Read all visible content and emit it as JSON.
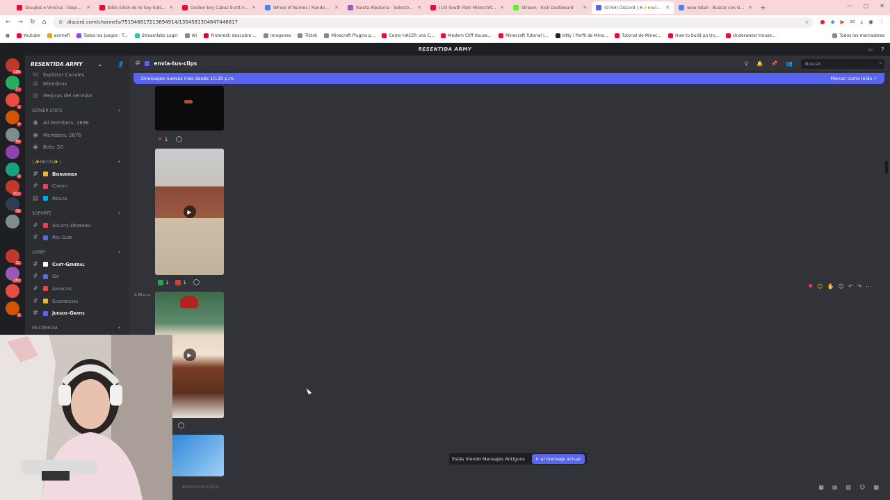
{
  "browser": {
    "tabs": [
      {
        "title": "Douglas e Vinicius - Esquadrão",
        "color": "#ff0033",
        "active": false
      },
      {
        "title": "Billie Eilish de Yo Soy Kids reacc",
        "color": "#ff0033",
        "active": false
      },
      {
        "title": "Golden boy Cabuz Scott nos re",
        "color": "#ff0033",
        "active": false
      },
      {
        "title": "Wheel of Names | Random nam",
        "color": "#4285f4",
        "active": false
      },
      {
        "title": "Ruleta Aleatoria - Selector Ran",
        "color": "#9b59b6",
        "active": false
      },
      {
        "title": "(10) South Park Minecraft 6/5",
        "color": "#ff0033",
        "active": false
      },
      {
        "title": "Stream - Kick Dashboard",
        "color": "#53fc18",
        "active": false
      },
      {
        "title": "(9764) Discord | #✨envia-tus",
        "color": "#5865f2",
        "active": true
      },
      {
        "title": "wow retail - Buscar con Google",
        "color": "#4285f4",
        "active": false
      }
    ],
    "url": "discord.com/channels/751946817213694914/1354581304847446817",
    "bookmarks": [
      {
        "label": "Youtube",
        "color": "#ff0033"
      },
      {
        "label": "animefl",
        "color": "#f0a020"
      },
      {
        "label": "Todos los juegos - T...",
        "color": "#9146ff"
      },
      {
        "label": "Streamlabs Login",
        "color": "#31c3a2"
      },
      {
        "label": "Ali",
        "color": "#888888"
      },
      {
        "label": "Pinterest: descubre ...",
        "color": "#e60023"
      },
      {
        "label": "Imagenes",
        "color": "#888888"
      },
      {
        "label": "Tiktok",
        "color": "#888888"
      },
      {
        "label": "Minecraft Plugins p...",
        "color": "#888888"
      },
      {
        "label": "Como HACER una C...",
        "color": "#ff0033"
      },
      {
        "label": "Modern Cliff House...",
        "color": "#ff0033"
      },
      {
        "label": "Minecraft Tutorial |...",
        "color": "#ff0033"
      },
      {
        "label": "kitty | Perfil de Mine...",
        "color": "#222222"
      },
      {
        "label": "Tutorial de Minec...",
        "color": "#ff0033"
      },
      {
        "label": "How to build an Un...",
        "color": "#ff0033"
      },
      {
        "label": "Underwater House...",
        "color": "#ff0033"
      },
      {
        "label": "Todos los marcadores",
        "color": "#888888"
      }
    ]
  },
  "app": {
    "top_title": "RESENTIDA ARMY"
  },
  "guild": {
    "name": "RESENTIDA ARMY",
    "top_items": [
      "Explorar Canales",
      "Miembros",
      "Mejoras del servidor"
    ],
    "categories": [
      {
        "name": "SERVER STATS",
        "channels": [
          {
            "label": "All Members: 2696",
            "bold": false,
            "type": "voice"
          },
          {
            "label": "Members: 2676",
            "bold": false,
            "type": "voice"
          },
          {
            "label": "Bots: 20",
            "bold": false,
            "type": "voice"
          }
        ]
      },
      {
        "name": "| ✨INICIO✨ |",
        "channels": [
          {
            "label": "bienvenida",
            "bold": true,
            "type": "text",
            "color": "#f0b232"
          },
          {
            "label": "chasto",
            "bold": false,
            "type": "text",
            "color": "#f23f43"
          },
          {
            "label": "reglas",
            "bold": false,
            "type": "rules",
            "color": "#00a8fc"
          }
        ]
      },
      {
        "name": "SOPORTE",
        "channels": [
          {
            "label": "solicita-desbaneo",
            "bold": false,
            "type": "text",
            "color": "#f23f43"
          },
          {
            "label": "rol-subs",
            "bold": false,
            "type": "text",
            "color": "#5865f2"
          }
        ]
      },
      {
        "name": "LOBBY",
        "channels": [
          {
            "label": "chat-general",
            "bold": true,
            "type": "text",
            "color": "#ffffff"
          },
          {
            "label": "gif",
            "bold": false,
            "type": "text",
            "color": "#5865f2"
          },
          {
            "label": "anuncios",
            "bold": false,
            "type": "text",
            "color": "#f23f43"
          },
          {
            "label": "sugerencias",
            "bold": false,
            "type": "text",
            "color": "#f0b232"
          },
          {
            "label": "juegos-gratis",
            "bold": true,
            "type": "text",
            "color": "#5865f2"
          }
        ]
      },
      {
        "name": "MULTIMEDIA",
        "channels": []
      }
    ]
  },
  "channel": {
    "name": "envia-tus-clips",
    "search_placeholder": "Buscar"
  },
  "banner": {
    "text": "3mensajes nuevos más desde 10:39 p.m.",
    "action": "Marcar como leído"
  },
  "messages": [
    {
      "reactions": [
        {
          "emoji": "cross",
          "count": "1",
          "color": "#f23f43"
        }
      ]
    },
    {
      "reactions": [
        {
          "emoji": "check",
          "count": "1",
          "color": "#23a55a"
        },
        {
          "emoji": "flag",
          "count": "1",
          "color": "#d83c3e"
        }
      ]
    },
    {
      "time": "2:38 p.m.",
      "reactions": []
    }
  ],
  "old_messages": {
    "text": "Estás Viendo Mensajes Antiguos",
    "button": "Ir al mensaje actual"
  },
  "composer": {
    "placeholder": "Envia-tus-Clips"
  },
  "servers": [
    {
      "color": "#c0392b",
      "badge": "199"
    },
    {
      "color": "#27ae60",
      "badge": "11"
    },
    {
      "color": "#e74c3c",
      "badge": "2"
    },
    {
      "color": "#d35400",
      "badge": "4"
    },
    {
      "color": "#7f8c8d",
      "badge": "94"
    },
    {
      "color": "#8e44ad",
      "badge": ""
    },
    {
      "color": "#16a085",
      "badge": "2"
    },
    {
      "color": "#c0392b",
      "badge": "812"
    },
    {
      "color": "#2c3e50",
      "badge": "10"
    },
    {
      "color": "#7f8c8d",
      "badge": ""
    },
    {
      "color": "#1e1f22",
      "badge": ""
    },
    {
      "color": "#c0392b",
      "badge": "31"
    },
    {
      "color": "#9b59b6",
      "badge": "384"
    },
    {
      "color": "#e74c3c",
      "badge": ""
    },
    {
      "color": "#d35400",
      "badge": "2"
    }
  ]
}
